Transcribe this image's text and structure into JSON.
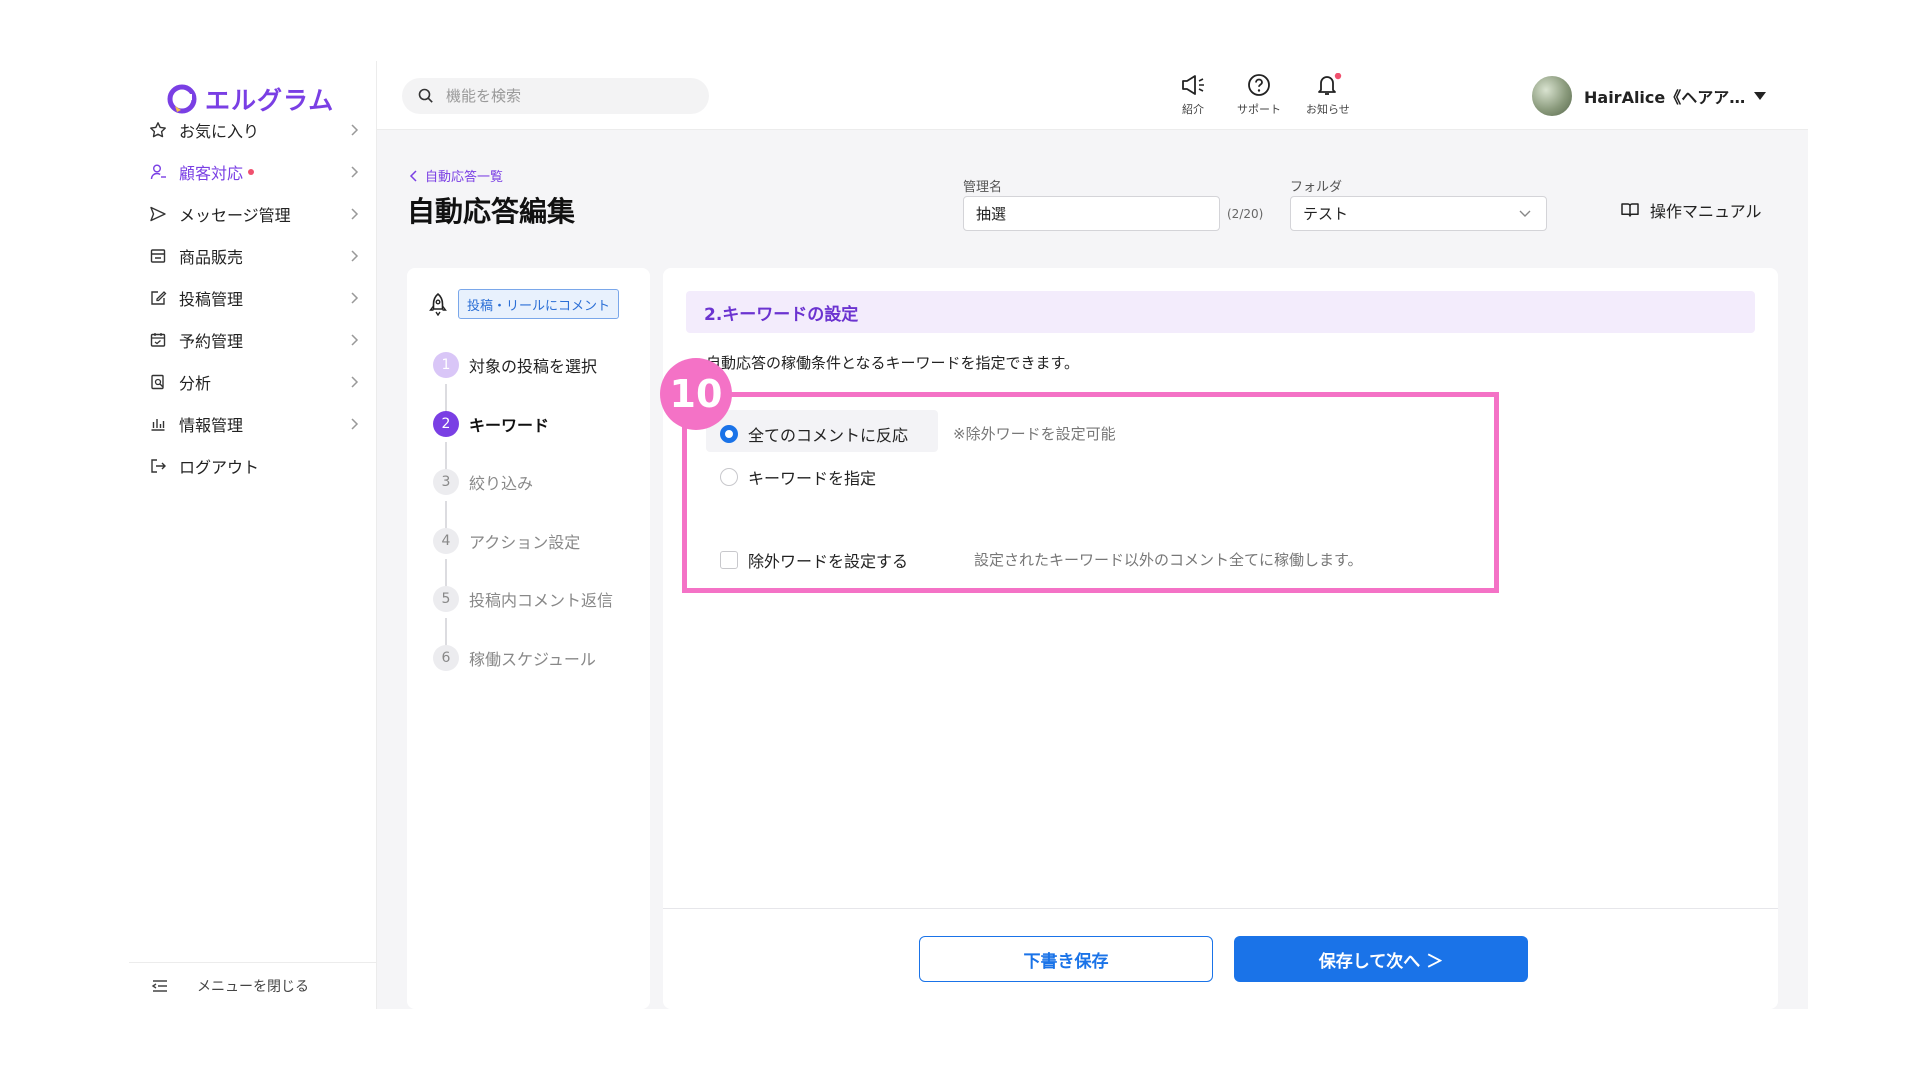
{
  "app": {
    "logo_text": "エルグラム"
  },
  "sidebar": {
    "items": [
      {
        "label": "お気に入り"
      },
      {
        "label": "顧客対応"
      },
      {
        "label": "メッセージ管理"
      },
      {
        "label": "商品販売"
      },
      {
        "label": "投稿管理"
      },
      {
        "label": "予約管理"
      },
      {
        "label": "分析"
      },
      {
        "label": "情報管理"
      },
      {
        "label": "ログアウト"
      }
    ],
    "collapse_label": "メニューを閉じる"
  },
  "topbar": {
    "search_placeholder": "機能を検索",
    "icons": [
      {
        "label": "紹介"
      },
      {
        "label": "サポート"
      },
      {
        "label": "お知らせ"
      }
    ],
    "user_name": "HairAlice《ヘアア…"
  },
  "page": {
    "breadcrumb": "自動応答一覧",
    "title": "自動応答編集",
    "name_label": "管理名",
    "name_value": "抽選",
    "name_counter": "(2/20)",
    "folder_label": "フォルダ",
    "folder_value": "テスト",
    "manual_label": "操作マニュアル"
  },
  "steps": {
    "badge": "投稿・リールにコメント",
    "items": [
      {
        "num": "1",
        "label": "対象の投稿を選択"
      },
      {
        "num": "2",
        "label": "キーワード"
      },
      {
        "num": "3",
        "label": "絞り込み"
      },
      {
        "num": "4",
        "label": "アクション設定"
      },
      {
        "num": "5",
        "label": "投稿内コメント返信"
      },
      {
        "num": "6",
        "label": "稼働スケジュール"
      }
    ]
  },
  "keyword": {
    "section_title": "2.キーワードの設定",
    "description": "自動応答の稼働条件となるキーワードを指定できます。",
    "option_all": "全てのコメントに反応",
    "option_all_hint": "※除外ワードを設定可能",
    "option_specify": "キーワードを指定",
    "exclude_label": "除外ワードを設定する",
    "exclude_hint": "設定されたキーワード以外のコメント全てに稼働します。",
    "annotation_number": "10"
  },
  "footer": {
    "draft_button": "下書き保存",
    "next_button": "保存して次へ ＞"
  },
  "colors": {
    "brand_purple": "#7a3fe4",
    "primary_blue": "#1a73e8",
    "highlight_pink": "#f472c6"
  }
}
